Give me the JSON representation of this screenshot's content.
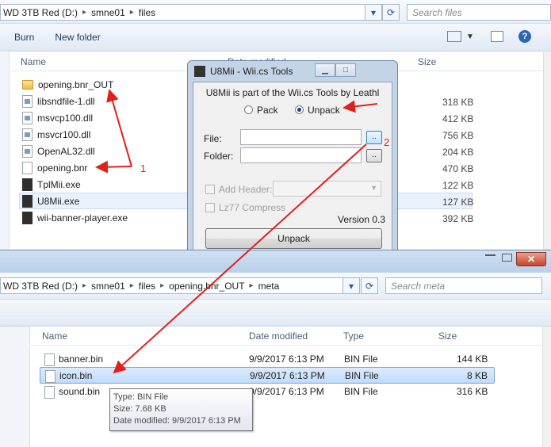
{
  "back_window": {
    "address": [
      "WD 3TB Red (D:)",
      "smne01",
      "files"
    ],
    "search_placeholder": "Search files",
    "commands": {
      "burn": "Burn",
      "new_folder": "New folder"
    },
    "columns": {
      "name": "Name",
      "date": "Date modified",
      "size": "Size"
    },
    "files": [
      {
        "name": "opening.bnr_OUT",
        "icon": "folder-icon",
        "size": ""
      },
      {
        "name": "libsndfile-1.dll",
        "icon": "dll-icon",
        "size": "318 KB"
      },
      {
        "name": "msvcp100.dll",
        "icon": "dll-icon",
        "size": "412 KB"
      },
      {
        "name": "msvcr100.dll",
        "icon": "dll-icon",
        "size": "756 KB"
      },
      {
        "name": "OpenAL32.dll",
        "icon": "dll-icon",
        "size": "204 KB"
      },
      {
        "name": "opening.bnr",
        "icon": "file-icon",
        "size": "470 KB"
      },
      {
        "name": "TplMii.exe",
        "icon": "exe-icon",
        "size": "122 KB"
      },
      {
        "name": "U8Mii.exe",
        "icon": "exe-icon",
        "size": "127 KB"
      },
      {
        "name": "wii-banner-player.exe",
        "icon": "exe-icon",
        "size": "392 KB"
      }
    ]
  },
  "dialog": {
    "title": "U8Mii - Wii.cs Tools",
    "header": "U8Mii is part of the Wii.cs Tools by Leathl",
    "pack_label": "Pack",
    "unpack_label": "Unpack",
    "file_label": "File:",
    "folder_label": "Folder:",
    "browse_label": "..",
    "add_header_label": "Add Header:",
    "lz77_label": "Lz77 Compress",
    "version": "Version 0.3",
    "unpack_button": "Unpack"
  },
  "annotations": {
    "one": "1",
    "two": "2"
  },
  "front_window": {
    "address": [
      "WD 3TB Red (D:)",
      "smne01",
      "files",
      "opening.bnr_OUT",
      "meta"
    ],
    "search_placeholder": "Search meta",
    "columns": {
      "name": "Name",
      "date": "Date modified",
      "type": "Type",
      "size": "Size"
    },
    "files": [
      {
        "name": "banner.bin",
        "date": "9/9/2017 6:13 PM",
        "type": "BIN File",
        "size": "144 KB"
      },
      {
        "name": "icon.bin",
        "date": "9/9/2017 6:13 PM",
        "type": "BIN File",
        "size": "8 KB"
      },
      {
        "name": "sound.bin",
        "date": "9/9/2017 6:13 PM",
        "type": "BIN File",
        "size": "316 KB"
      }
    ],
    "tooltip": {
      "type": "Type: BIN File",
      "size": "Size: 7.68 KB",
      "date": "Date modified: 9/9/2017 6:13 PM"
    }
  },
  "colors": {
    "arrow": "#e0201b",
    "selection": "#cde4fc"
  }
}
